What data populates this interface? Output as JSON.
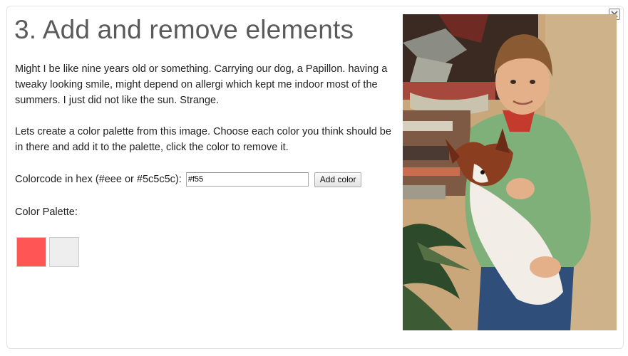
{
  "title": "3. Add and remove elements",
  "intro": "Might I be like nine years old or something. Carrying our dog, a Papillon. having a tweaky looking smile, might depend on allergi which kept me indoor most of the summers. I just did not like the sun. Strange.",
  "instructions": "Lets create a color palette from this image. Choose each color you think should be in there and add it to the palette, click the color to remove it.",
  "color_form": {
    "label": "Colorcode in hex (#eee or #5c5c5c):",
    "input_value": "#f55",
    "button_label": "Add color"
  },
  "palette": {
    "label": "Color Palette:",
    "colors": [
      "#ff5555",
      "#eeeeee"
    ]
  },
  "photo": {
    "subject": "boy-holding-papillon-dog-photo"
  },
  "close_icon": "close-icon"
}
